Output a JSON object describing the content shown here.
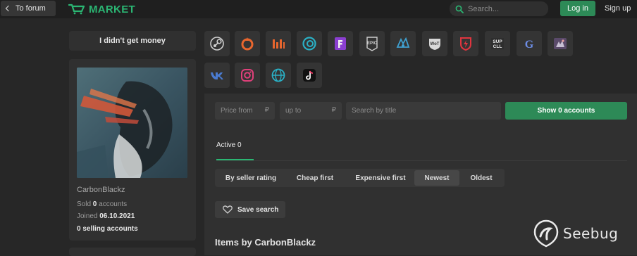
{
  "header": {
    "back_label": "To forum",
    "logo_text": "MARKET",
    "search_placeholder": "Search...",
    "login_label": "Log in",
    "signup_label": "Sign up"
  },
  "sidebar": {
    "title": "I didn't get money",
    "username": "CarbonBlackz",
    "sold_prefix": "Sold",
    "sold_count": "0",
    "sold_suffix": "accounts",
    "joined_label": "Joined",
    "joined_date": "06.10.2021",
    "selling": "0 selling accounts"
  },
  "game_icons": [
    "steam-icon",
    "origin-icon",
    "battlenet-icon",
    "uplay-icon",
    "fortnite-icon",
    "epic-games-icon",
    "escape-from-tarkov-icon",
    "world-of-tanks-icon",
    "warface-icon",
    "supercell-icon",
    "genshin-icon",
    "discord-icon",
    "vk-icon",
    "instagram-icon",
    "proxy-globe-icon",
    "tiktok-icon"
  ],
  "filters": {
    "price_from_placeholder": "Price from",
    "price_to_placeholder": "up to",
    "currency_symbol": "₽",
    "title_search_placeholder": "Search by title",
    "show_button": "Show 0 accounts"
  },
  "tabs": {
    "active_label": "Active 0"
  },
  "sort_options": [
    "By seller rating",
    "Cheap first",
    "Expensive first",
    "Newest",
    "Oldest"
  ],
  "sort_active": "Newest",
  "save_search_label": "Save search",
  "items_title": "Items by CarbonBlackz",
  "watermark_text": "Seebug",
  "colors": {
    "accent": "#2bb673",
    "button_green": "#2d8a57",
    "background": "#272727",
    "panel": "#303030"
  }
}
